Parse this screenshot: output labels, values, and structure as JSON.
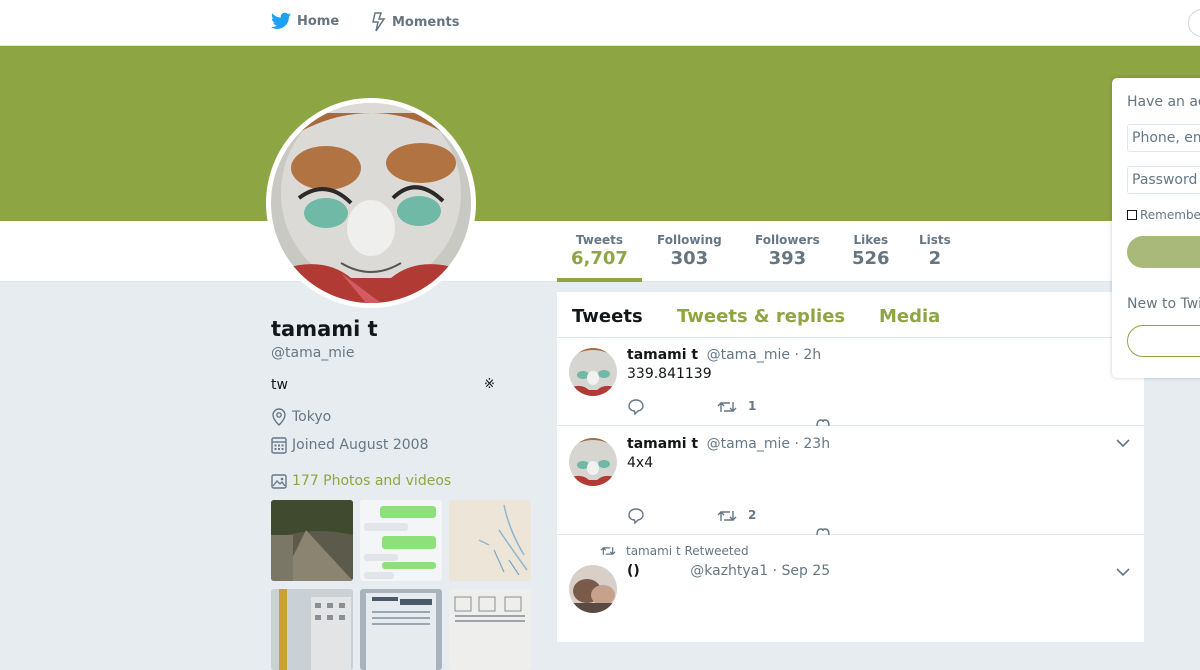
{
  "topbar": {
    "home_label": "Home",
    "moments_label": "Moments"
  },
  "colors": {
    "accent": "#8ea543",
    "twitter_blue": "#1da1f2"
  },
  "profile": {
    "name": "tamami t",
    "handle": "@tama_mie",
    "bio": "tw",
    "bio_mark": "※",
    "location": "Tokyo",
    "joined": "Joined August 2008",
    "photos_link": "177 Photos and videos"
  },
  "stats": [
    {
      "label": "Tweets",
      "value": "6,707"
    },
    {
      "label": "Following",
      "value": "303"
    },
    {
      "label": "Followers",
      "value": "393"
    },
    {
      "label": "Likes",
      "value": "526"
    },
    {
      "label": "Lists",
      "value": "2"
    }
  ],
  "tabs": [
    {
      "label": "Tweets"
    },
    {
      "label": "Tweets & replies"
    },
    {
      "label": "Media"
    }
  ],
  "tweets": [
    {
      "name": "tamami t",
      "handle": "@tama_mie",
      "time": "· 2h",
      "text": "339.841139",
      "likes": "1"
    },
    {
      "name": "tamami t",
      "handle": "@tama_mie",
      "time": "· 23h",
      "text": "4x4",
      "likes": "2"
    },
    {
      "retweet_label": "tamami t Retweeted",
      "name": "()",
      "handle": "@kazhtya1",
      "time": "· Sep 25"
    }
  ],
  "login": {
    "title": "Have an account?",
    "phone_placeholder": "Phone, email or username",
    "password_placeholder": "Password",
    "remember": "Remember me",
    "signup_title": "New to Twitter?"
  }
}
